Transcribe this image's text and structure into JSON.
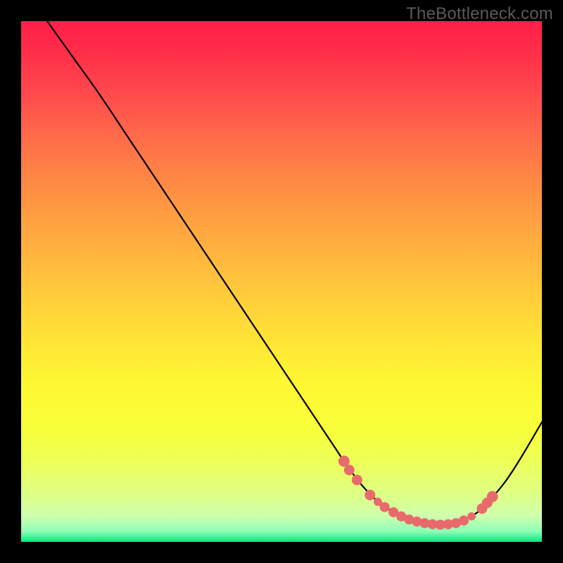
{
  "watermark": "TheBottleneck.com",
  "colors": {
    "curve": "#000000",
    "marker_fill": "#e86a6a",
    "marker_stroke": "#c74848"
  },
  "chart_data": {
    "type": "line",
    "title": "",
    "xlabel": "",
    "ylabel": "",
    "xlim": [
      0,
      100
    ],
    "ylim": [
      0,
      100
    ],
    "series": [
      {
        "name": "curve",
        "x": [
          5,
          10,
          15,
          20,
          25,
          30,
          35,
          40,
          45,
          50,
          55,
          60,
          62,
          65,
          68,
          70,
          72,
          74,
          76,
          78,
          80,
          82,
          84,
          86,
          88,
          90,
          93,
          96,
          100
        ],
        "y": [
          100,
          93,
          86,
          78.5,
          71,
          63.5,
          56,
          48.5,
          41,
          33.5,
          26,
          18.5,
          15.5,
          11.4,
          8.2,
          6.6,
          5.4,
          4.5,
          3.9,
          3.5,
          3.3,
          3.4,
          3.8,
          4.6,
          6.0,
          8.0,
          11.6,
          16.2,
          23.0
        ]
      }
    ],
    "markers": {
      "name": "highlight-dots",
      "points": [
        {
          "x": 62.0,
          "y": 15.5,
          "r": 1.1
        },
        {
          "x": 63.0,
          "y": 13.8,
          "r": 1.0
        },
        {
          "x": 64.5,
          "y": 11.9,
          "r": 1.0
        },
        {
          "x": 67.0,
          "y": 9.0,
          "r": 1.0
        },
        {
          "x": 68.5,
          "y": 7.7,
          "r": 0.6
        },
        {
          "x": 69.8,
          "y": 6.7,
          "r": 0.9
        },
        {
          "x": 71.5,
          "y": 5.7,
          "r": 0.9
        },
        {
          "x": 73.0,
          "y": 4.9,
          "r": 0.9
        },
        {
          "x": 74.5,
          "y": 4.3,
          "r": 0.9
        },
        {
          "x": 76.0,
          "y": 3.9,
          "r": 0.9
        },
        {
          "x": 77.5,
          "y": 3.6,
          "r": 0.9
        },
        {
          "x": 79.0,
          "y": 3.4,
          "r": 0.9
        },
        {
          "x": 80.5,
          "y": 3.3,
          "r": 0.9
        },
        {
          "x": 82.0,
          "y": 3.4,
          "r": 0.9
        },
        {
          "x": 83.5,
          "y": 3.6,
          "r": 0.9
        },
        {
          "x": 85.0,
          "y": 4.1,
          "r": 0.9
        },
        {
          "x": 86.5,
          "y": 4.9,
          "r": 0.6
        },
        {
          "x": 88.5,
          "y": 6.4,
          "r": 1.0
        },
        {
          "x": 89.5,
          "y": 7.5,
          "r": 1.0
        },
        {
          "x": 90.5,
          "y": 8.7,
          "r": 1.1
        }
      ]
    }
  }
}
